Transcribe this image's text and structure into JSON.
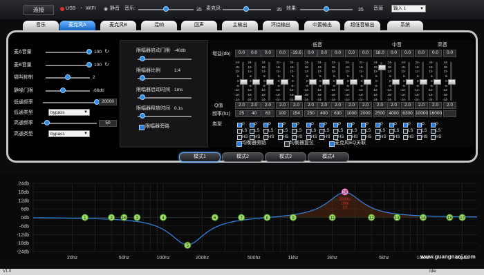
{
  "topbar": {
    "connect": "连接",
    "usb": "USB",
    "wifi": "WIFI",
    "mute": "静音",
    "music_label": "音乐:",
    "music_value": "35",
    "mic_label": "麦克风:",
    "mic_value": "35",
    "effect_label": "效果:",
    "effect_value": "35",
    "source_label": "音源",
    "source_value": "输入 1"
  },
  "tabs": [
    "音乐",
    "麦克风A",
    "麦克风B",
    "混响",
    "回声",
    "主输出",
    "环绕输出",
    "中置输出",
    "超低音输出",
    "系统"
  ],
  "active_tab": 1,
  "left_panel": {
    "micA_vol_label": "麦A音量",
    "micA_vol": "100",
    "micB_vol_label": "麦B音量",
    "micB_vol": "100",
    "feedback_label": "啸叫抑制",
    "feedback": "2",
    "noise_gate_label": "静噪门限",
    "noise_gate": "-66db",
    "lowpass_freq_label": "低通频率",
    "lowpass_freq": "20000",
    "lowpass_type_label": "低通类型",
    "lowpass_type": "bypass",
    "highpass_freq_label": "高通频率",
    "highpass_freq": "50",
    "highpass_type_label": "高通类型",
    "highpass_type": "bypass"
  },
  "limiter": {
    "threshold_label": "限幅器启动门限",
    "threshold": "-40db",
    "ratio_label": "限幅器比例",
    "ratio": "1:4",
    "attack_label": "限幅器启动时间",
    "attack": "1ms",
    "release_label": "限幅器释放时间",
    "release": "0.1s",
    "bypass_label": "限幅器旁路"
  },
  "eq": {
    "gain_label": "增益(db)",
    "q_label": "Q值",
    "freq_label": "频率(hz)",
    "type_label": "类型",
    "band_low": "低音",
    "band_mid": "中音",
    "band_high": "高音",
    "gains": [
      "0.0",
      "0.0",
      "0.0",
      "0.0",
      "-19.6",
      "0.0",
      "0.0",
      "0.0",
      "0.0",
      "0.0",
      "18.0",
      "0.0",
      "0.0",
      "0.0",
      "0.0",
      "0.0"
    ],
    "qs": [
      "2.0",
      "2.0",
      "2.0",
      "2.0",
      "2.0",
      "2.0",
      "2.0",
      "2.0",
      "2.0",
      "2.0",
      "2.0",
      "2.0",
      "2.0",
      "2.0",
      "2.0",
      "2.0"
    ],
    "freqs": [
      "25",
      "40",
      "63",
      "100",
      "154",
      "250",
      "400",
      "630",
      "1000",
      "2000",
      "2500",
      "4000",
      "6300",
      "10000",
      "16000",
      ""
    ],
    "scale": [
      "24-",
      "18-",
      "12-",
      "6-",
      "0-",
      "-6-",
      "-12-",
      "-18-",
      "-24-"
    ],
    "type_p": "P",
    "type_ls": "LS",
    "type_hs": "HS",
    "bypass_label": "均衡器旁路",
    "reset_label": "均衡器复位",
    "link_label": "麦克风EQ关联"
  },
  "modes": [
    "模式1",
    "模式2",
    "模式3",
    "模式4"
  ],
  "active_mode": 0,
  "graph": {
    "y_ticks": [
      "24db",
      "18db",
      "12db",
      "6db",
      "0db",
      "-6db",
      "-12db",
      "-18db",
      "-24db"
    ],
    "x_ticks": [
      "20hz",
      "50hz",
      "100hz",
      "200hz",
      "500hz",
      "1khz",
      "2khz",
      "5khz",
      "10khz",
      "20khz"
    ],
    "points": [
      "1",
      "2",
      "16",
      "3",
      "4",
      "5",
      "6",
      "7",
      "8",
      "9",
      "10",
      "11",
      "12",
      "13",
      "14",
      "15",
      "17"
    ],
    "highlight_text": [
      "2500hz",
      "18db",
      "2.0"
    ],
    "watermark": "www.guangnaoj.com"
  },
  "colors": {
    "accent": "#2b8de6",
    "curve": "#2f7fd6",
    "point": "#7dd24a",
    "highlight": "#e85bb4"
  },
  "status": {
    "version": "V1.0",
    "state": "Idle"
  }
}
